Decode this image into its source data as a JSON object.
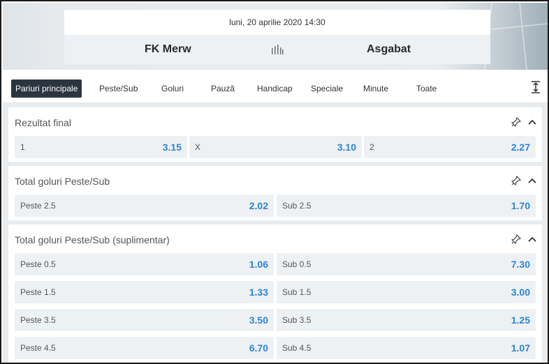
{
  "header": {
    "date": "luni, 20 aprilie 2020 14:30",
    "home_team": "FK Merw",
    "away_team": "Asgabat",
    "stats_icon": "stats-bars-icon"
  },
  "tabs": [
    {
      "label": "Pariuri principale",
      "active": true
    },
    {
      "label": "Peste/Sub"
    },
    {
      "label": "Goluri"
    },
    {
      "label": "Pauză"
    },
    {
      "label": "Handicap"
    },
    {
      "label": "Speciale"
    },
    {
      "label": "Minute"
    },
    {
      "label": "Toate"
    }
  ],
  "markets": [
    {
      "title": "Rezultat final",
      "rows": [
        [
          {
            "label": "1",
            "odd": "3.15"
          },
          {
            "label": "X",
            "odd": "3.10"
          },
          {
            "label": "2",
            "odd": "2.27"
          }
        ]
      ]
    },
    {
      "title": "Total goluri Peste/Sub",
      "rows": [
        [
          {
            "label": "Peste 2.5",
            "odd": "2.02"
          },
          {
            "label": "Sub 2.5",
            "odd": "1.70"
          }
        ]
      ]
    },
    {
      "title": "Total goluri Peste/Sub (suplimentar)",
      "rows": [
        [
          {
            "label": "Peste 0.5",
            "odd": "1.06"
          },
          {
            "label": "Sub 0.5",
            "odd": "7.30"
          }
        ],
        [
          {
            "label": "Peste 1.5",
            "odd": "1.33"
          },
          {
            "label": "Sub 1.5",
            "odd": "3.00"
          }
        ],
        [
          {
            "label": "Peste 3.5",
            "odd": "3.50"
          },
          {
            "label": "Sub 3.5",
            "odd": "1.25"
          }
        ],
        [
          {
            "label": "Peste 4.5",
            "odd": "6.70"
          },
          {
            "label": "Sub 4.5",
            "odd": "1.07"
          }
        ]
      ]
    }
  ],
  "colors": {
    "accent": "#2b84d8",
    "active_tab": "#2c3440",
    "odd_bg": "#eef1f3"
  }
}
